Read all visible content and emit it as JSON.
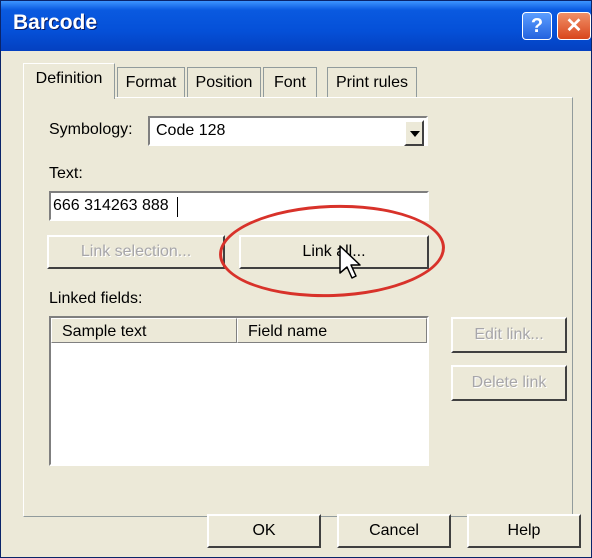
{
  "window": {
    "title": "Barcode"
  },
  "titlebar": {
    "help_glyph": "?",
    "close_glyph": "✕"
  },
  "tabs": [
    "Definition",
    "Format",
    "Position",
    "Font",
    "Print rules"
  ],
  "symbology": {
    "label": "Symbology:",
    "value": "Code 128"
  },
  "text_field": {
    "label": "Text:",
    "value": "666 314263 888"
  },
  "buttons": {
    "link_selection": "Link selection...",
    "link_all": "Link all...",
    "edit_link": "Edit link...",
    "delete_link": "Delete link",
    "ok": "OK",
    "cancel": "Cancel",
    "help": "Help"
  },
  "linked_fields": {
    "label": "Linked fields:",
    "columns": [
      "Sample text",
      "Field name"
    ],
    "rows": []
  },
  "colors": {
    "titlebar": "#0550d8",
    "annotation": "#d8322a",
    "face": "#ece9d8"
  }
}
